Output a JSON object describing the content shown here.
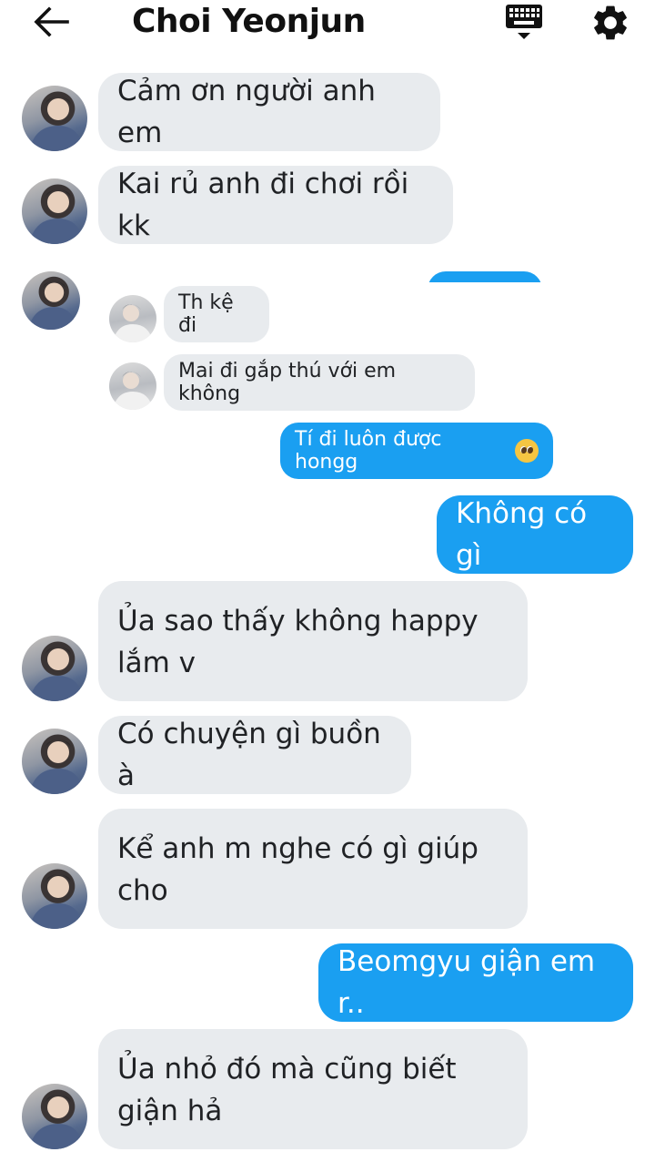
{
  "header": {
    "title": "Choi Yeonjun",
    "back_icon": "arrow-left-icon",
    "keyboard_icon": "keyboard-icon",
    "settings_icon": "gear-icon"
  },
  "colors": {
    "incoming_bubble": "#e8ebee",
    "outgoing_bubble": "#1a9ff1"
  },
  "messages": [
    {
      "side": "in",
      "text": "Cảm ơn người anh em"
    },
    {
      "side": "in",
      "text": "Kai rủ anh đi chơi rồi kk"
    },
    {
      "side": "in",
      "type": "shared-chat"
    },
    {
      "side": "out",
      "text": "Không có gì"
    },
    {
      "side": "in",
      "text": "Ủa sao thấy không happy lắm v"
    },
    {
      "side": "in",
      "text": "Có chuyện gì buồn à"
    },
    {
      "side": "in",
      "text": "Kể anh m nghe có gì giúp cho"
    },
    {
      "side": "out",
      "text": "Beomgyu giận em r.."
    },
    {
      "side": "in",
      "text": "Ủa nhỏ đó mà cũng biết giận hả"
    }
  ],
  "shared_chat": {
    "messages": [
      {
        "side": "in",
        "text": "Th kệ đi"
      },
      {
        "side": "in",
        "text": "Mai đi gắp thú với em không"
      },
      {
        "side": "out",
        "text": "Tí đi luôn được hongg",
        "emoji": "pleading-face"
      }
    ]
  }
}
